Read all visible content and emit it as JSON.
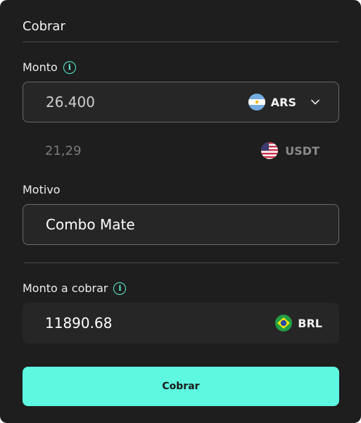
{
  "header": {
    "title": "Cobrar"
  },
  "amount": {
    "label": "Monto",
    "value": "26.400",
    "currency": "ARS",
    "currency_flag": "argentina-flag",
    "converted_value": "21,29",
    "converted_currency": "USDT",
    "converted_flag": "usa-flag"
  },
  "reason": {
    "label": "Motivo",
    "value": "Combo Mate"
  },
  "charge_amount": {
    "label": "Monto a cobrar",
    "value": "11890.68",
    "currency": "BRL",
    "currency_flag": "brazil-flag"
  },
  "actions": {
    "submit_label": "Cobrar"
  },
  "colors": {
    "accent": "#5ef8e0",
    "background": "#1e1e1e",
    "field": "#262626"
  }
}
